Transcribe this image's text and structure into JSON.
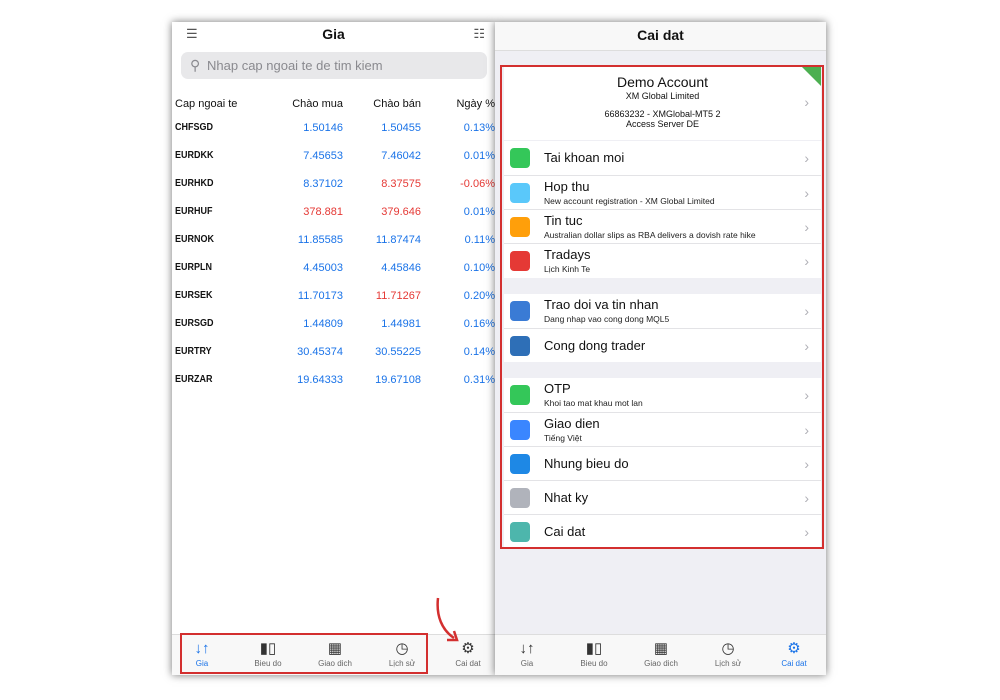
{
  "left": {
    "title": "Gia",
    "search_placeholder": "Nhap cap ngoai te de tim kiem",
    "columns": [
      "Cap ngoai te",
      "Chào mua",
      "Chào bán",
      "Ngày %"
    ],
    "rows": [
      {
        "symbol": "CHFSGD",
        "bid": "1.50146",
        "ask": "1.50455",
        "change": "0.13%"
      },
      {
        "symbol": "EURDKK",
        "bid": "7.45653",
        "ask": "7.46042",
        "change": "0.01%"
      },
      {
        "symbol": "EURHKD",
        "bid": "8.37102",
        "ask": "8.37575",
        "change": "-0.06%"
      },
      {
        "symbol": "EURHUF",
        "bid": "378.881",
        "ask": "379.646",
        "change": "0.01%"
      },
      {
        "symbol": "EURNOK",
        "bid": "11.85585",
        "ask": "11.87474",
        "change": "0.11%"
      },
      {
        "symbol": "EURPLN",
        "bid": "4.45003",
        "ask": "4.45846",
        "change": "0.10%"
      },
      {
        "symbol": "EURSEK",
        "bid": "11.70173",
        "ask": "11.71267",
        "change": "0.20%"
      },
      {
        "symbol": "EURSGD",
        "bid": "1.44809",
        "ask": "1.44981",
        "change": "0.16%"
      },
      {
        "symbol": "EURTRY",
        "bid": "30.45374",
        "ask": "30.55225",
        "change": "0.14%"
      },
      {
        "symbol": "EURZAR",
        "bid": "19.64333",
        "ask": "19.67108",
        "change": "0.31%"
      }
    ],
    "tabs": [
      "Gia",
      "Bieu do",
      "Giao dich",
      "Lịch sử",
      "Cai dat"
    ]
  },
  "right": {
    "title": "Cai dat",
    "account": {
      "name": "Demo Account",
      "company": "XM Global Limited",
      "server_line": "66863232 - XMGlobal-MT5 2",
      "access": "Access Server DE",
      "tag": "Demo"
    },
    "group1": [
      {
        "title": "Tai khoan moi",
        "subtitle": "",
        "icon": "add-user-icon",
        "color": "#34c759"
      },
      {
        "title": "Hop thu",
        "subtitle": "New account registration - XM Global Limited",
        "icon": "mail-icon",
        "color": "#5ac8fa"
      },
      {
        "title": "Tin tuc",
        "subtitle": "Australian dollar slips as RBA delivers a dovish rate hike",
        "icon": "news-icon",
        "color": "#ff9f0a"
      },
      {
        "title": "Tradays",
        "subtitle": "Lịch Kinh Te",
        "icon": "calendar-icon",
        "color": "#e53935"
      }
    ],
    "group2": [
      {
        "title": "Trao doi va tin nhan",
        "subtitle": "Dang nhap vao cong dong MQL5",
        "icon": "chat-icon",
        "color": "#3a7bd5"
      },
      {
        "title": "Cong dong trader",
        "subtitle": "",
        "icon": "mql-icon",
        "color": "#2e6fb7"
      }
    ],
    "group3": [
      {
        "title": "OTP",
        "subtitle": "Khoi tao mat khau mot lan",
        "icon": "lock-icon",
        "color": "#34c759"
      },
      {
        "title": "Giao dien",
        "subtitle": "Tiếng Việt",
        "icon": "language-icon",
        "color": "#3a86ff"
      },
      {
        "title": "Nhung bieu do",
        "subtitle": "",
        "icon": "candles-icon",
        "color": "#1e88e5"
      },
      {
        "title": "Nhat ky",
        "subtitle": "",
        "icon": "journal-icon",
        "color": "#b0b3bb"
      },
      {
        "title": "Cai dat",
        "subtitle": "",
        "icon": "settings-app-icon",
        "color": "#4db6ac"
      }
    ],
    "tabs": [
      "Gia",
      "Bieu do",
      "Giao dich",
      "Lịch sử",
      "Cai dat"
    ]
  },
  "colors": {
    "positive": "#1a73e8",
    "negative": "#e53935",
    "highlight_box": "#d32f2f"
  }
}
